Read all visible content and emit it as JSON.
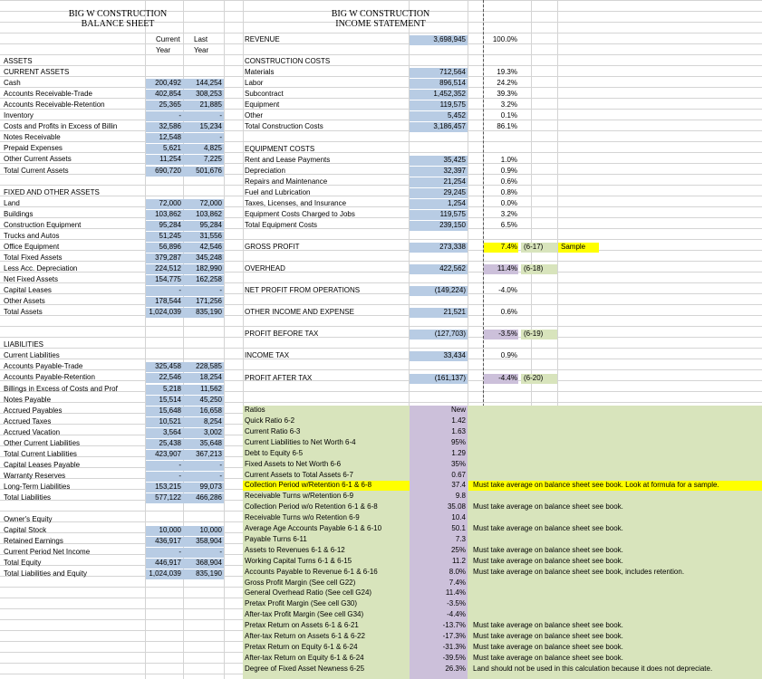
{
  "balance": {
    "title1": "BIG W CONSTRUCTION",
    "title2": "BALANCE SHEET",
    "col_current": "Current",
    "col_last": "Last",
    "col_year": "Year",
    "rows": [
      [
        "ASSETS",
        "",
        ""
      ],
      [
        "CURRENT ASSETS",
        "",
        ""
      ],
      [
        "Cash",
        "200,492",
        "144,254"
      ],
      [
        "Accounts Receivable-Trade",
        "402,854",
        "308,253"
      ],
      [
        "Accounts Receivable-Retention",
        "25,365",
        "21,885"
      ],
      [
        "Inventory",
        "-",
        "-"
      ],
      [
        "Costs and Profits in Excess of Billin",
        "32,586",
        "15,234"
      ],
      [
        "Notes Receivable",
        "12,548",
        "-"
      ],
      [
        "Prepaid Expenses",
        "5,621",
        "4,825"
      ],
      [
        "Other Current Assets",
        "11,254",
        "7,225"
      ],
      [
        "Total Current Assets",
        "690,720",
        "501,676"
      ],
      [
        "",
        "",
        ""
      ],
      [
        "FIXED AND OTHER ASSETS",
        "",
        ""
      ],
      [
        "Land",
        "72,000",
        "72,000"
      ],
      [
        "Buildings",
        "103,862",
        "103,862"
      ],
      [
        "Construction Equipment",
        "95,284",
        "95,284"
      ],
      [
        "Trucks and Autos",
        "51,245",
        "31,556"
      ],
      [
        "Office Equipment",
        "56,896",
        "42,546"
      ],
      [
        "Total Fixed Assets",
        "379,287",
        "345,248"
      ],
      [
        "Less Acc. Depreciation",
        "224,512",
        "182,990"
      ],
      [
        "Net Fixed Assets",
        "154,775",
        "162,258"
      ],
      [
        "Capital Leases",
        "-",
        "-"
      ],
      [
        "Other Assets",
        "178,544",
        "171,256"
      ],
      [
        "Total Assets",
        "1,024,039",
        "835,190"
      ],
      [
        "",
        "",
        ""
      ],
      [
        "",
        "",
        ""
      ],
      [
        "LIABILITIES",
        "",
        ""
      ],
      [
        "Current Liabilities",
        "",
        ""
      ],
      [
        "Accounts Payable-Trade",
        "325,458",
        "228,585"
      ],
      [
        "Accounts Payable-Retention",
        "22,546",
        "18,254"
      ],
      [
        "Billings in Excess of Costs and Prof",
        "5,218",
        "11,562"
      ],
      [
        "Notes Payable",
        "15,514",
        "45,250"
      ],
      [
        "Accrued Payables",
        "15,648",
        "16,658"
      ],
      [
        "Accrued Taxes",
        "10,521",
        "8,254"
      ],
      [
        "Accrued Vacation",
        "3,564",
        "3,002"
      ],
      [
        "Other Current Liabilities",
        "25,438",
        "35,648"
      ],
      [
        "Total Current Liabilities",
        "423,907",
        "367,213"
      ],
      [
        "Capital Leases Payable",
        "-",
        "-"
      ],
      [
        "Warranty Reserves",
        "-",
        "-"
      ],
      [
        "Long-Term Liabilities",
        "153,215",
        "99,073"
      ],
      [
        "Total Liabilities",
        "577,122",
        "466,286"
      ],
      [
        "",
        "",
        ""
      ],
      [
        "Owner's Equity",
        "",
        ""
      ],
      [
        "Capital Stock",
        "10,000",
        "10,000"
      ],
      [
        "Retained Earnings",
        "436,917",
        "358,904"
      ],
      [
        "Current Period Net Income",
        "-",
        "-"
      ],
      [
        "Total Equity",
        "446,917",
        "368,904"
      ],
      [
        "Total Liabilities and Equity",
        "1,024,039",
        "835,190"
      ]
    ]
  },
  "income": {
    "title1": "BIG W CONSTRUCTION",
    "title2": "INCOME STATEMENT",
    "rows": [
      [
        "REVENUE",
        "3,698,945",
        "100.0%",
        ""
      ],
      [
        "",
        "",
        "",
        ""
      ],
      [
        "CONSTRUCTION COSTS",
        "",
        "",
        ""
      ],
      [
        "Materials",
        "712,564",
        "19.3%",
        ""
      ],
      [
        "Labor",
        "896,514",
        "24.2%",
        ""
      ],
      [
        "Subcontract",
        "1,452,352",
        "39.3%",
        ""
      ],
      [
        "Equipment",
        "119,575",
        "3.2%",
        ""
      ],
      [
        "Other",
        "5,452",
        "0.1%",
        ""
      ],
      [
        "Total Construction Costs",
        "3,186,457",
        "86.1%",
        ""
      ],
      [
        "",
        "",
        "",
        ""
      ],
      [
        "EQUIPMENT COSTS",
        "",
        "",
        ""
      ],
      [
        "Rent and Lease Payments",
        "35,425",
        "1.0%",
        ""
      ],
      [
        "Depreciation",
        "32,397",
        "0.9%",
        ""
      ],
      [
        "Repairs and Maintenance",
        "21,254",
        "0.6%",
        ""
      ],
      [
        "Fuel and Lubrication",
        "29,245",
        "0.8%",
        ""
      ],
      [
        "Taxes, Licenses, and Insurance",
        "1,254",
        "0.0%",
        ""
      ],
      [
        "Equipment Costs Charged to Jobs",
        "119,575",
        "3.2%",
        ""
      ],
      [
        "Total Equipment Costs",
        "239,150",
        "6.5%",
        ""
      ],
      [
        "",
        "",
        "",
        ""
      ],
      [
        "GROSS PROFIT",
        "273,338",
        "7.4%",
        "(6-17)"
      ],
      [
        "",
        "",
        "",
        ""
      ],
      [
        "OVERHEAD",
        "422,562",
        "11.4%",
        "(6-18)"
      ],
      [
        "",
        "",
        "",
        ""
      ],
      [
        "NET PROFIT FROM OPERATIONS",
        "(149,224)",
        "-4.0%",
        ""
      ],
      [
        "",
        "",
        "",
        ""
      ],
      [
        "OTHER INCOME AND EXPENSE",
        "21,521",
        "0.6%",
        ""
      ],
      [
        "",
        "",
        "",
        ""
      ],
      [
        "PROFIT BEFORE TAX",
        "(127,703)",
        "-3.5%",
        "(6-19)"
      ],
      [
        "",
        "",
        "",
        ""
      ],
      [
        "INCOME TAX",
        "33,434",
        "0.9%",
        ""
      ],
      [
        "",
        "",
        "",
        ""
      ],
      [
        "PROFIT AFTER TAX",
        "(161,137)",
        "-4.4%",
        "(6-20)"
      ]
    ],
    "sample": "Sample"
  },
  "ratios": {
    "header": "Ratios",
    "new_label": "New",
    "rows": [
      [
        "Quick Ratio 6-2",
        "1.42",
        ""
      ],
      [
        "Current Ratio 6-3",
        "1.63",
        ""
      ],
      [
        "Current Liabilities to Net Worth 6-4",
        "95%",
        ""
      ],
      [
        "Debt to Equity 6-5",
        "1.29",
        ""
      ],
      [
        "Fixed Assets to Net Worth 6-6",
        "35%",
        ""
      ],
      [
        "Current Assets to Total Assets 6-7",
        "0.67",
        ""
      ],
      [
        "Collection Period w/Retention 6-1 & 6-8",
        "37.4",
        "Must take average on balance sheet see book. Look at formula for a sample."
      ],
      [
        "Receivable Turns w/Retention 6-9",
        "9.8",
        ""
      ],
      [
        "Collection Period w/o Retention 6-1 & 6-8",
        "35.08",
        "Must take average on balance sheet see book."
      ],
      [
        "Receivable Turns w/o Retention 6-9",
        "10.4",
        ""
      ],
      [
        "Average Age Accounts Payable 6-1 & 6-10",
        "50.1",
        "Must take average on balance sheet see book."
      ],
      [
        "Payable Turns 6-11",
        "7.3",
        ""
      ],
      [
        "Assets to Revenues 6-1 & 6-12",
        "25%",
        "Must take average on balance sheet see book."
      ],
      [
        "Working Capital Turns 6-1 & 6-15",
        "11.2",
        "Must take average on balance sheet see book."
      ],
      [
        "Accounts Payable to Revenue 6-1 & 6-16",
        "8.0%",
        "Must take average on balance sheet see book, includes retention."
      ],
      [
        "Gross Profit Margin (See cell G22)",
        "7.4%",
        ""
      ],
      [
        "General Overhead Ratio (See cell G24)",
        "11.4%",
        ""
      ],
      [
        "Pretax Profit Margin (See cell G30)",
        "-3.5%",
        ""
      ],
      [
        "After-tax Profit Margin (See cell G34)",
        "-4.4%",
        ""
      ],
      [
        "Pretax Return on Assets 6-1 & 6-21",
        "-13.7%",
        "Must take average on balance sheet see book."
      ],
      [
        "After-tax Return on Assets 6-1 & 6-22",
        "-17.3%",
        "Must take average on balance sheet see book."
      ],
      [
        "Pretax Return on Equity 6-1 & 6-24",
        "-31.3%",
        "Must take average on balance sheet see book."
      ],
      [
        "After-tax Return on Equity 6-1 & 6-24",
        "-39.5%",
        "Must take average on balance sheet see book."
      ],
      [
        "Degree of Fixed Asset Newness 6-25",
        "26.3%",
        "Land should not be used in this calculation because it does not depreciate."
      ]
    ]
  }
}
